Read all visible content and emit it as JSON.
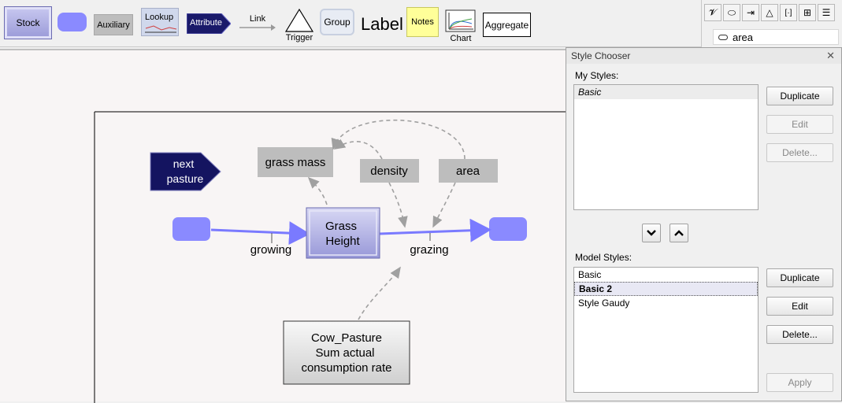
{
  "toolbar": {
    "stock": "Stock",
    "auxiliary": "Auxiliary",
    "lookup": "Lookup",
    "attribute": "Attribute",
    "link": "Link",
    "trigger": "Trigger",
    "group": "Group",
    "label": "Label",
    "notes": "Notes",
    "chart": "Chart",
    "aggregate": "Aggregate"
  },
  "right_panel": {
    "tabs": [
      "script-v-icon",
      "flow-icon",
      "import-icon",
      "triangle-icon",
      "bracket-icon",
      "tree-icon",
      "list-icon"
    ],
    "tab_glyphs": [
      "𝓥",
      "⬭",
      "⇥",
      "△",
      "[·]",
      "⊞",
      "☰"
    ],
    "list_item": "area"
  },
  "diagram": {
    "attribute": "next\npasture",
    "aux_grass_mass": "grass mass",
    "aux_density": "density",
    "aux_area": "area",
    "stock": "Grass\nHeight",
    "flow_in": "growing",
    "flow_out": "grazing",
    "aggregate": "Cow_Pasture\nSum actual\nconsumption rate"
  },
  "chooser": {
    "title": "Style Chooser",
    "my_styles_label": "My Styles:",
    "my_styles": [
      "Basic"
    ],
    "model_styles_label": "Model Styles:",
    "model_styles": [
      "Basic",
      "Basic 2",
      "Style Gaudy"
    ],
    "selected_model_style": "Basic 2",
    "buttons": {
      "duplicate": "Duplicate",
      "edit": "Edit",
      "delete": "Delete...",
      "apply": "Apply"
    }
  },
  "colors": {
    "stock_fill": "#a8a8e0",
    "flow": "#7a7aff",
    "aux_fill": "#bdbdbd",
    "attribute_fill": "#1a1a6a",
    "link": "#a0a0a0"
  }
}
